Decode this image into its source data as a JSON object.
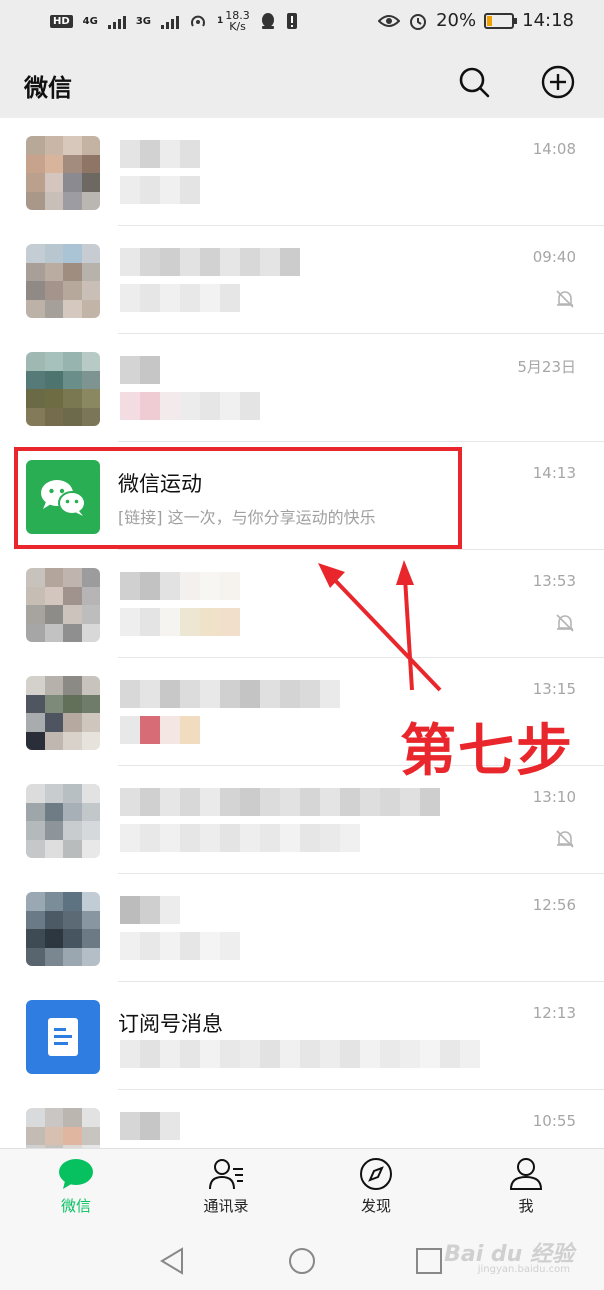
{
  "status_bar": {
    "hd_label": "HD",
    "signal_1": "4G",
    "signal_2": "3G",
    "speed_value": "18.3",
    "speed_unit": "K/s",
    "speed_prefix": "1",
    "battery_percent": "20%",
    "battery_level": 0.2,
    "time": "14:18"
  },
  "header": {
    "title": "微信",
    "icons": [
      "search-icon",
      "add-icon"
    ]
  },
  "chats": [
    {
      "time": "14:08",
      "muted": false,
      "pixelated": true
    },
    {
      "time": "09:40",
      "muted": true,
      "pixelated": true
    },
    {
      "time": "5月23日",
      "muted": false,
      "pixelated": true
    },
    {
      "name": "微信运动",
      "preview": "[链接] 这一次，与你分享运动的快乐",
      "time": "14:13",
      "muted": false,
      "pixelated": false
    },
    {
      "time": "13:53",
      "muted": true,
      "pixelated": true
    },
    {
      "time": "13:15",
      "muted": false,
      "pixelated": true
    },
    {
      "time": "13:10",
      "muted": true,
      "pixelated": true
    },
    {
      "time": "12:56",
      "muted": false,
      "pixelated": true
    },
    {
      "name": "订阅号消息",
      "time": "12:13",
      "muted": false,
      "pixelated": true
    },
    {
      "time": "10:55",
      "muted": false,
      "pixelated": true
    }
  ],
  "annotation": {
    "label": "第七步",
    "color": "#e8262b"
  },
  "tabs": [
    {
      "label": "微信",
      "icon": "chat-bubble-icon",
      "active": true
    },
    {
      "label": "通讯录",
      "icon": "contacts-icon",
      "active": false
    },
    {
      "label": "发现",
      "icon": "compass-icon",
      "active": false
    },
    {
      "label": "我",
      "icon": "person-icon",
      "active": false
    }
  ],
  "nav": [
    "back-icon",
    "home-icon",
    "recents-icon"
  ],
  "watermark": {
    "brand": "Bai du 经验",
    "url": "jingyan.baidu.com"
  },
  "colors": {
    "accent": "#07c160",
    "wechat_green": "#2aae54",
    "subscription_blue": "#2f7de1",
    "annotation_red": "#e8262b"
  }
}
